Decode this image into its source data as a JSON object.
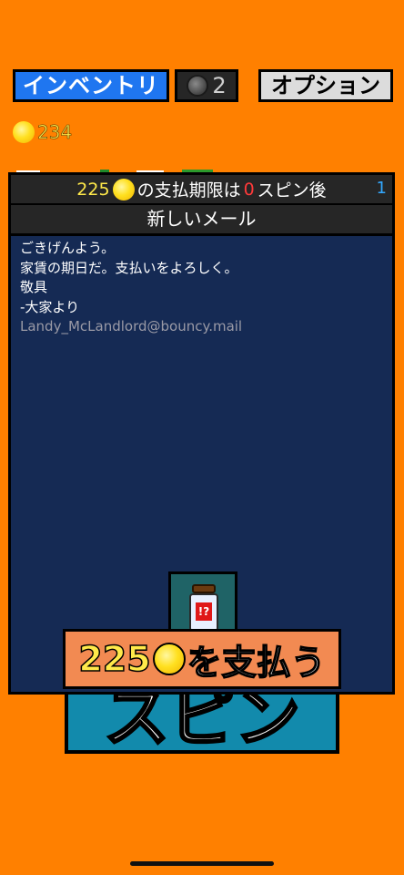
{
  "topbar": {
    "inventory_label": "インベントリ",
    "reroll_count": "2",
    "options_label": "オプション"
  },
  "coins": {
    "count": "234"
  },
  "modal": {
    "rent_amount": "225",
    "rent_text_1": "の支払期限は",
    "rent_spins": "0",
    "rent_text_2": "スピン後",
    "page_number": "1",
    "mail_title": "新しいメール",
    "mail_lines": [
      "ごきげんよう。",
      "家賃の期日だ。支払いをよろしく。",
      "敬具",
      "-大家より",
      "Landy_McLandlord@bouncy.mail"
    ],
    "item_label": "!?"
  },
  "pay_button": {
    "amount": "225",
    "text": "を支払う"
  },
  "spin_button": {
    "label": "スピン"
  },
  "colors": {
    "background": "#ff8000",
    "inventory_button": "#1f76f0",
    "modal_body": "#152a54",
    "pay_button": "#f28a52",
    "spin_button": "#128aac",
    "coin": "#ffe020"
  },
  "icons": [
    "coin-icon",
    "reroll-token-icon",
    "jar-item-icon"
  ]
}
